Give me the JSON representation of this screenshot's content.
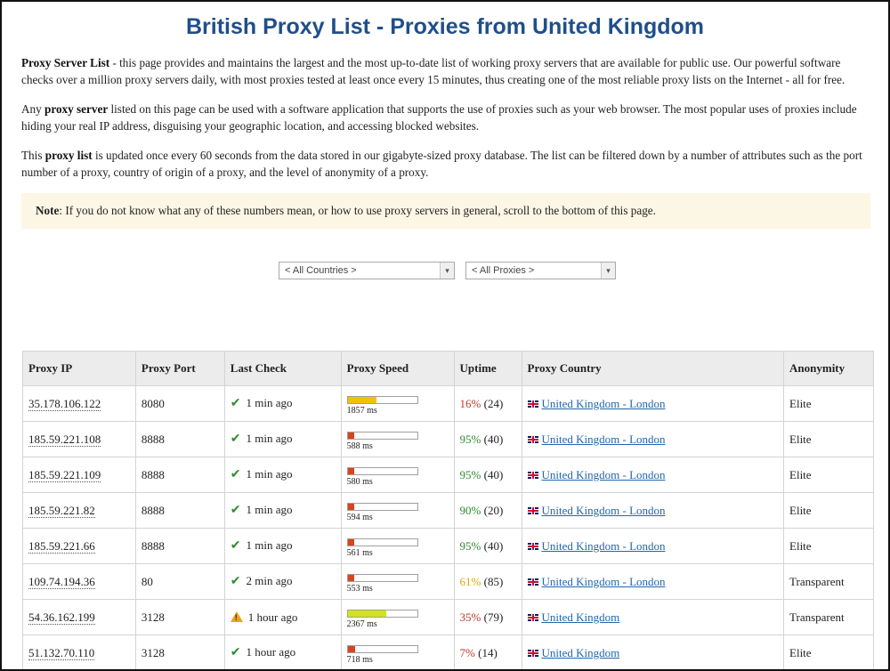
{
  "page": {
    "title": "British Proxy List - Proxies from United Kingdom"
  },
  "intro": [
    {
      "bold": "Proxy Server List",
      "pre": "",
      "text": " - this page provides and maintains the largest and the most up-to-date list of working proxy servers that are available for public use. Our powerful software checks over a million proxy servers daily, with most proxies tested at least once every 15 minutes, thus creating one of the most reliable proxy lists on the Internet - all for free."
    },
    {
      "pre": "Any ",
      "bold": "proxy server",
      "text": " listed on this page can be used with a software application that supports the use of proxies such as your web browser. The most popular uses of proxies include hiding your real IP address, disguising your geographic location, and accessing blocked websites."
    },
    {
      "pre": "This ",
      "bold": "proxy list",
      "text": " is updated once every 60 seconds from the data stored in our gigabyte-sized proxy database. The list can be filtered down by a number of attributes such as the port number of a proxy, country of origin of a proxy, and the level of anonymity of a proxy."
    }
  ],
  "note": {
    "label": "Note",
    "text": ": If you do not know what any of these numbers mean, or how to use proxy servers in general, scroll to the bottom of this page."
  },
  "filters": {
    "country": "< All Countries >",
    "proxies": "< All Proxies >"
  },
  "table": {
    "headers": [
      "Proxy IP",
      "Proxy Port",
      "Last Check",
      "Proxy Speed",
      "Uptime",
      "Proxy Country",
      "Anonymity"
    ],
    "rows": [
      {
        "ip": "35.178.106.122",
        "port": "8080",
        "check_icon": "check-icon",
        "check": "1 min ago",
        "speed_fraction": 0.42,
        "speed_color": "#f2c200",
        "speed": "1857 ms",
        "uptime_pct": "16%",
        "uptime_count": " (24)",
        "uptime_class": "upct-red",
        "country": "United Kingdom - London",
        "anonymity": "Elite",
        "anon_class": "anon-elite"
      },
      {
        "ip": "185.59.221.108",
        "port": "8888",
        "check_icon": "check-icon",
        "check": "1 min ago",
        "speed_fraction": 0.09,
        "speed_color": "#d9441c",
        "speed": "588 ms",
        "uptime_pct": "95%",
        "uptime_count": " (40)",
        "uptime_class": "upct-green",
        "country": "United Kingdom - London",
        "anonymity": "Elite",
        "anon_class": "anon-elite"
      },
      {
        "ip": "185.59.221.109",
        "port": "8888",
        "check_icon": "check-icon",
        "check": "1 min ago",
        "speed_fraction": 0.09,
        "speed_color": "#d9441c",
        "speed": "580 ms",
        "uptime_pct": "95%",
        "uptime_count": " (40)",
        "uptime_class": "upct-green",
        "country": "United Kingdom - London",
        "anonymity": "Elite",
        "anon_class": "anon-elite"
      },
      {
        "ip": "185.59.221.82",
        "port": "8888",
        "check_icon": "check-icon",
        "check": "1 min ago",
        "speed_fraction": 0.09,
        "speed_color": "#d9441c",
        "speed": "594 ms",
        "uptime_pct": "90%",
        "uptime_count": " (20)",
        "uptime_class": "upct-green",
        "country": "United Kingdom - London",
        "anonymity": "Elite",
        "anon_class": "anon-elite"
      },
      {
        "ip": "185.59.221.66",
        "port": "8888",
        "check_icon": "check-icon",
        "check": "1 min ago",
        "speed_fraction": 0.09,
        "speed_color": "#d9441c",
        "speed": "561 ms",
        "uptime_pct": "95%",
        "uptime_count": " (40)",
        "uptime_class": "upct-green",
        "country": "United Kingdom - London",
        "anonymity": "Elite",
        "anon_class": "anon-elite"
      },
      {
        "ip": "109.74.194.36",
        "port": "80",
        "check_icon": "check-icon",
        "check": "2 min ago",
        "speed_fraction": 0.09,
        "speed_color": "#d9441c",
        "speed": "553 ms",
        "uptime_pct": "61%",
        "uptime_count": " (85)",
        "uptime_class": "upct-orange",
        "country": "United Kingdom - London",
        "anonymity": "Transparent",
        "anon_class": "anon-trans"
      },
      {
        "ip": "54.36.162.199",
        "port": "3128",
        "check_icon": "warning-icon",
        "check": "1 hour ago",
        "speed_fraction": 0.55,
        "speed_color": "#d4e21a",
        "speed": "2367 ms",
        "uptime_pct": "35%",
        "uptime_count": " (79)",
        "uptime_class": "upct-red",
        "country": "United Kingdom",
        "anonymity": "Transparent",
        "anon_class": "anon-trans"
      },
      {
        "ip": "51.132.70.110",
        "port": "3128",
        "check_icon": "check-icon",
        "check": "1 hour ago",
        "speed_fraction": 0.11,
        "speed_color": "#d9441c",
        "speed": "718 ms",
        "uptime_pct": "7%",
        "uptime_count": " (14)",
        "uptime_class": "upct-red",
        "country": "United Kingdom",
        "anonymity": "Elite",
        "anon_class": "anon-elite"
      }
    ]
  }
}
